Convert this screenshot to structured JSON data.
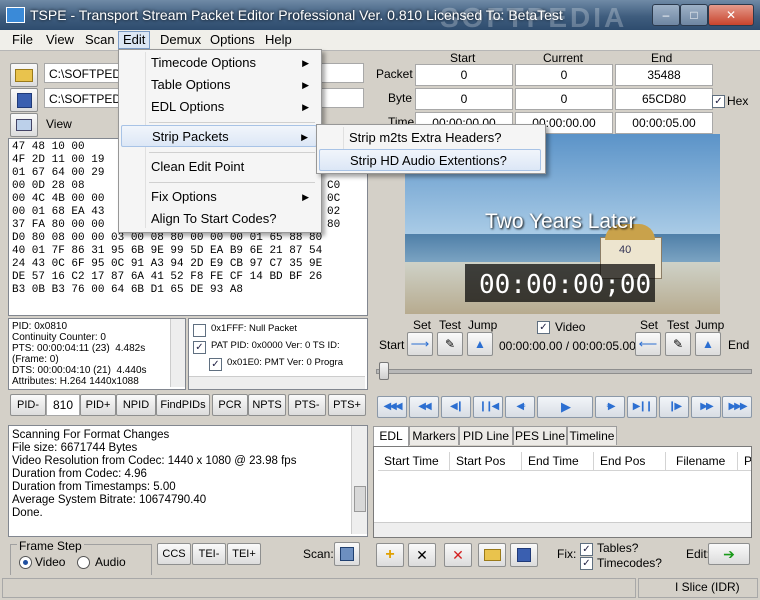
{
  "window": {
    "title": "TSPE - Transport Stream Packet Editor Professional Ver. 0.810 Licensed To: BetaTest",
    "watermark": "SOFTPEDIA"
  },
  "menubar": {
    "items": [
      "File",
      "View",
      "Scan",
      "Edit",
      "Demux",
      "Options",
      "Help"
    ],
    "active": "Edit"
  },
  "files": {
    "input": "C:\\SOFTPEDIA",
    "output": "C:\\SOFTPEDIA",
    "view_label": "View"
  },
  "edit_menu": {
    "timecode": "Timecode Options",
    "table": "Table Options",
    "edl": "EDL Options",
    "strip": "Strip Packets",
    "clean": "Clean Edit Point",
    "fix": "Fix Options",
    "align": "Align To Start Codes?"
  },
  "strip_submenu": {
    "item1": "Strip m2ts Extra Headers?",
    "item2": "Strip HD Audio Extentions?"
  },
  "hex_lines": [
    "47 48 10 00",
    "4F 2D 11 00 19",
    "01 67 64 00 29",
    "00 0D 28 08",
    "00 4C 4B 00 00",
    "00 01 68 EA 43",
    "37 FA 80 00 00",
    "D0 80 08 00 00 03 00 08 80 00 00 00 01 65 88 80",
    "40 01 7F 86 31 95 6B 9E 99 5D EA B9 6E 21 87 54",
    "24 43 0C 6F 95 0C 91 A3 94 2D E9 CB 97 C7 35 9E",
    "DE 57 16 C2 17 87 6A 41 52 F8 FE CF 14 BD BF 26",
    "B3 0B B3 76 00 64 6B D1 65 DE 93 A8"
  ],
  "hex_right_col": [
    "C0",
    "0C",
    "02",
    "80"
  ],
  "packet_info": [
    "PID: 0x0810",
    "Continuity Counter: 0",
    "PTS: 00:00:04:11 (23)  4.482s",
    "(Frame: 0)",
    "DTS: 00:00:04:10 (21)  4.440s",
    "Attributes: H.264 1440x1088"
  ],
  "pid_tree": [
    "0x1FFF: Null Packet",
    "PAT PID: 0x0000 Ver: 0 TS ID:",
    "0x01E0: PMT Ver: 0 Progra"
  ],
  "pid_bar": {
    "pid_minus": "PID-",
    "pid_value": "810",
    "pid_plus": "PID+",
    "npid": "NPID",
    "findpids": "FindPIDs",
    "pcr": "PCR",
    "npts": "NPTS",
    "pts_minus": "PTS-",
    "pts_plus": "PTS+"
  },
  "log_lines": [
    "Scanning For Format Changes",
    "File size: 6671744 Bytes",
    "Video Resolution from Codec: 1440 x 1080 @ 23.98 fps",
    "Duration from Codec: 4.96",
    "Duration from Timestamps: 5.00",
    "Average System Bitrate: 10674790.40",
    "Done."
  ],
  "frame_step": {
    "title": "Frame Step",
    "video": "Video",
    "audio": "Audio",
    "ccs": "CCS",
    "tei_minus": "TEI-",
    "tei_plus": "TEI+",
    "scan": "Scan:"
  },
  "position_grid": {
    "col_start": "Start",
    "col_current": "Current",
    "col_end": "End",
    "row_packet": "Packet",
    "row_byte": "Byte",
    "row_time": "Time",
    "packet_start": "0",
    "packet_current": "0",
    "packet_end": "35488",
    "byte_start": "0",
    "byte_current": "0",
    "byte_end": "65CD80",
    "time_start": "00:00:00.00",
    "time_current": "00:00:00.00",
    "time_end": "00:00:05.00",
    "hex_label": "Hex"
  },
  "video": {
    "caption": "Two Years Later",
    "timecode": "00:00:00;00",
    "tower_number": "40"
  },
  "transport": {
    "set": "Set",
    "test": "Test",
    "jump": "Jump",
    "video_label": "Video",
    "start_label": "Start",
    "end_label": "End",
    "time_display": "00:00:00.00 / 00:00:05.00"
  },
  "edl": {
    "tabs": [
      "EDL",
      "Markers",
      "PID Line",
      "PES Line",
      "Timeline"
    ],
    "columns": [
      "Start Time",
      "Start Pos",
      "End Time",
      "End Pos",
      "Filename",
      "Pl"
    ]
  },
  "bottom_right": {
    "fix_label": "Fix:",
    "tables": "Tables?",
    "timecodes": "Timecodes?",
    "edit_label": "Edit:"
  },
  "status": {
    "slice": "I Slice (IDR)"
  },
  "colors": {
    "title_bar": "#3f5d7e",
    "accent": "#2c6fd1",
    "close": "#c8442d"
  }
}
